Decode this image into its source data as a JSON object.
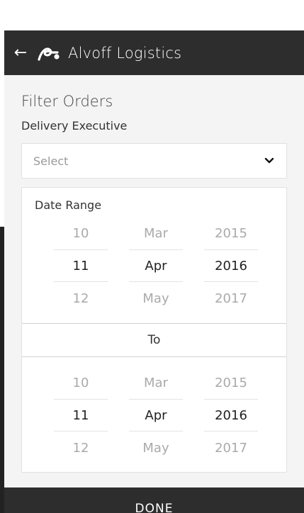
{
  "app": {
    "back_icon": "arrow-left-icon",
    "logo_icon": "alvoff-logo-icon",
    "title": "Alvoff Logistics"
  },
  "filter": {
    "heading": "Filter Orders",
    "delivery_label": "Delivery Executive",
    "select_placeholder": "Select",
    "date_range_label": "Date Range",
    "to_label": "To",
    "from": {
      "day": [
        "10",
        "11",
        "12"
      ],
      "month": [
        "Mar",
        "Apr",
        "May"
      ],
      "year": [
        "2015",
        "2016",
        "2017"
      ]
    },
    "to": {
      "day": [
        "10",
        "11",
        "12"
      ],
      "month": [
        "Mar",
        "Apr",
        "May"
      ],
      "year": [
        "2015",
        "2016",
        "2017"
      ]
    }
  },
  "done_label": "DONE",
  "colors": {
    "appbar": "#2d2d2d",
    "background": "#f4f4f4",
    "selected_text": "#222222",
    "dim_text": "#aaaaaa"
  }
}
